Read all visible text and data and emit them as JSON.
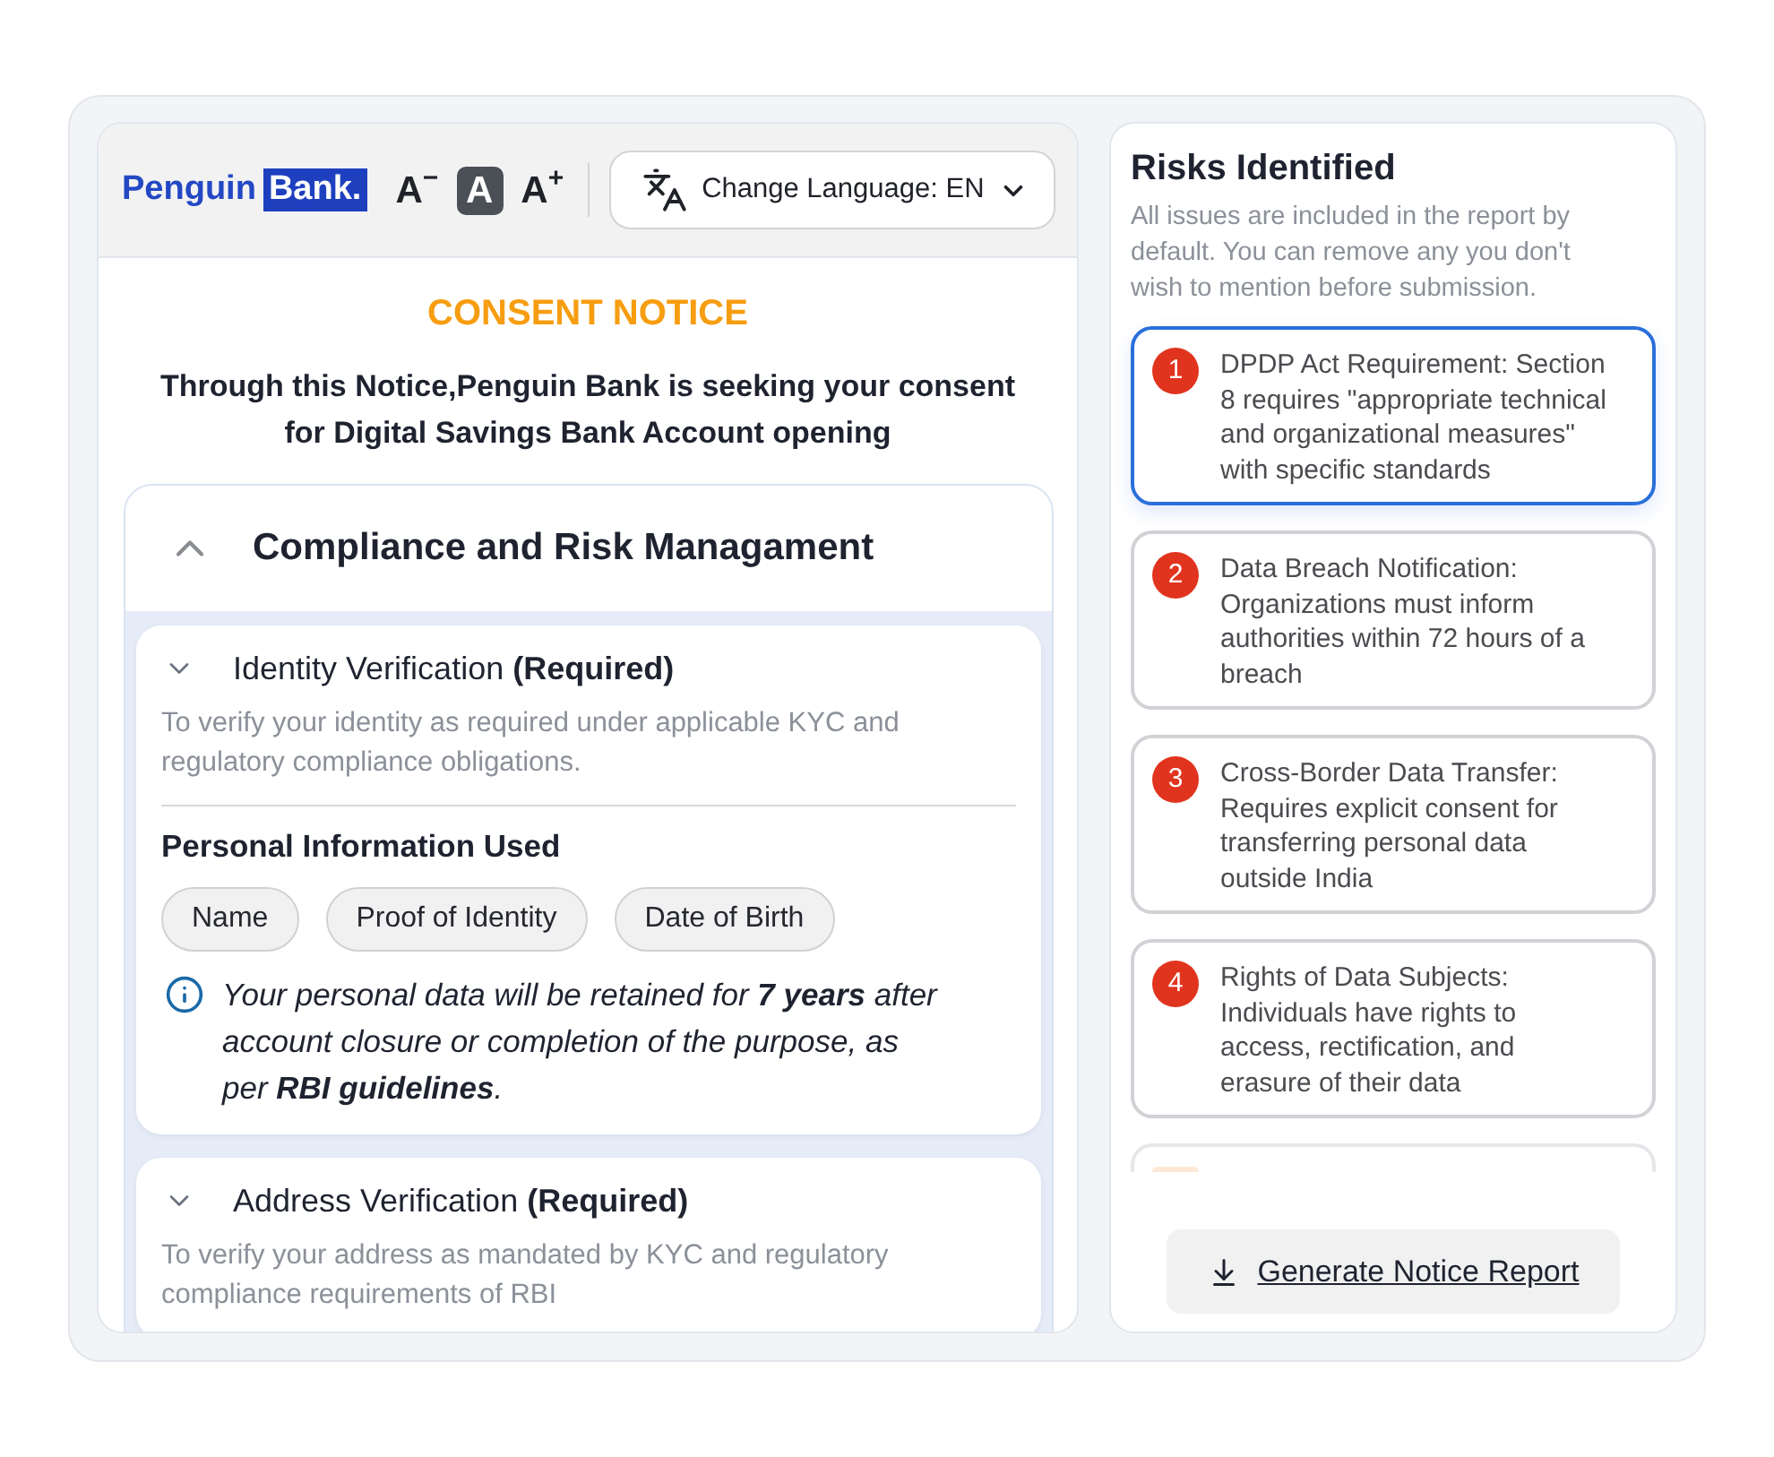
{
  "header": {
    "logo": {
      "text": "Penguin",
      "highlight": "Bank."
    },
    "font_size_controls": [
      {
        "label": "A",
        "sign": "−",
        "selected": false
      },
      {
        "label": "A",
        "selected": true
      },
      {
        "label": "A",
        "sign": "+",
        "selected": false
      }
    ],
    "language_button": "Change Language: EN"
  },
  "notice": {
    "title": "CONSENT NOTICE",
    "intro": "Through this Notice,Penguin Bank is seeking your consent for Digital Savings Bank Account opening"
  },
  "section": {
    "title": "Compliance and Risk Managament",
    "expanded": true,
    "purposes": [
      {
        "title": "Identity Verification **(Required)**",
        "description": "To verify your identity as required under applicable KYC and regulatory compliance obligations.",
        "info_heading": "Personal Information Used",
        "data_items": [
          "Name",
          "Proof of Identity",
          "Date of Birth"
        ],
        "retention_note": "Your personal data will be retained for **7 years** after account closure or completion of the purpose, as per **RBI guidelines**."
      },
      {
        "title": "Address Verification **(Required)**",
        "description": "To verify your address as mandated by KYC and regulatory compliance requirements of RBI"
      }
    ]
  },
  "risks_panel": {
    "title": "Risks Identified",
    "description": "All issues are included in the report by default. You can remove any you don't wish to mention before submission.",
    "risks": [
      {
        "number": "1",
        "text": "DPDP Act Requirement: Section 8 requires \"appropriate technical and organizational measures\" with specific standards",
        "selected": true
      },
      {
        "number": "2",
        "text": "Data Breach Notification: Organizations must inform authorities within 72 hours of a breach",
        "selected": false
      },
      {
        "number": "3",
        "text": "Cross-Border Data Transfer: Requires explicit consent for transferring personal data outside India",
        "selected": false
      },
      {
        "number": "4",
        "text": "Rights of Data Subjects: Individuals have rights to access, rectification, and erasure of their data",
        "selected": false
      }
    ],
    "generate_button": "Generate Notice Report"
  }
}
